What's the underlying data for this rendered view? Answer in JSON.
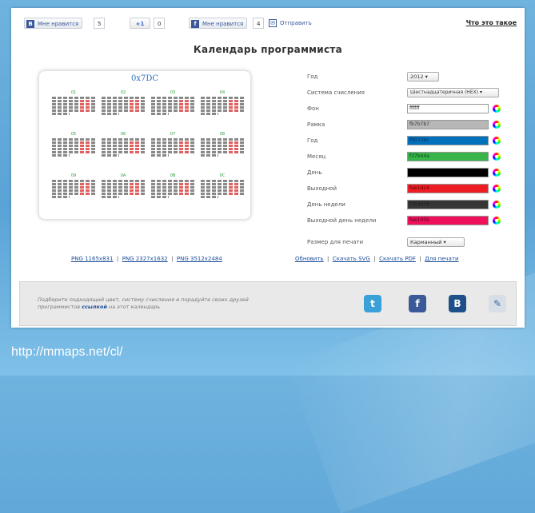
{
  "header": {
    "like_label": "Мне нравится",
    "like_count": "5",
    "gplus_label": "+1",
    "gplus_count": "0",
    "fb_like_label": "Мне нравится",
    "fb_count": "4",
    "fb_send_label": "Отправить",
    "what_link": "Что это такое"
  },
  "page_title": "Календарь программиста",
  "calendar": {
    "year_label": "0x7DC",
    "months": [
      "01",
      "02",
      "03",
      "04",
      "05",
      "06",
      "07",
      "08",
      "09",
      "0A",
      "0B",
      "0C"
    ]
  },
  "settings": {
    "year": {
      "label": "Год",
      "value": "2012"
    },
    "numeral_system": {
      "label": "Система счисления",
      "value": "Шестнадцатеричная (HEX)"
    },
    "colors": [
      {
        "label": "Фон",
        "value": "ffffff",
        "color": "#ffffff",
        "text": "#000000"
      },
      {
        "label": "Рамка",
        "value": "fb7b7b7",
        "color": "#b7b7b7",
        "text": "#333333"
      },
      {
        "label": "Год",
        "value": "f0072bc",
        "color": "#0072bc",
        "text": "#0b2b55"
      },
      {
        "label": "Месяц",
        "value": "f37b44a",
        "color": "#37b44a",
        "text": "#0d3f18"
      },
      {
        "label": "День",
        "value": "000000",
        "color": "#000000",
        "text": "#000000"
      },
      {
        "label": "Выходной",
        "value": "fee1d24",
        "color": "#ee1d24",
        "text": "#5a0000"
      },
      {
        "label": "День недели",
        "value": "f363636",
        "color": "#363636",
        "text": "#1a1a1a"
      },
      {
        "label": "Выходной день недели",
        "value": "fee105b",
        "color": "#ee105b",
        "text": "#5a0020"
      }
    ],
    "print_size": {
      "label": "Размер для печати",
      "value": "Карманный"
    }
  },
  "downloads": {
    "png_small": "PNG 1165x831",
    "png_medium": "PNG 2327x1632",
    "png_large": "PNG 3512x2484"
  },
  "actions": {
    "refresh": "Обновить",
    "svg": "Скачать SVG",
    "pdf": "Скачать PDF",
    "print": "Для печати"
  },
  "footer": {
    "text_before": "Подберите подходящий цвет, систему счисления и порадуйте своих друзей программистов ",
    "link": "ссылкой",
    "text_after": " на этот календарь",
    "social": [
      {
        "name": "twitter",
        "glyph": "t",
        "color": "#3aa0d8"
      },
      {
        "name": "facebook",
        "glyph": "f",
        "color": "#3b5998"
      },
      {
        "name": "vkontakte",
        "glyph": "B",
        "color": "#1f4f88"
      },
      {
        "name": "livejournal",
        "glyph": "✎",
        "color": "#d8dee6"
      }
    ]
  },
  "url": "http://mmaps.net/cl/"
}
